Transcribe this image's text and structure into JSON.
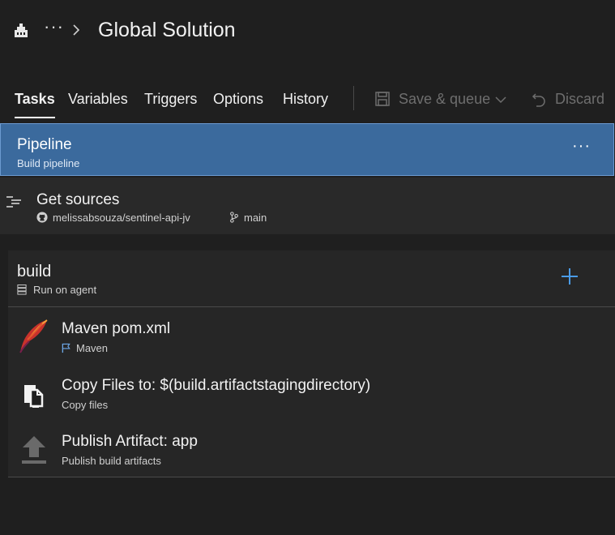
{
  "header": {
    "breadcrumb_more": "···",
    "title": "Global Solution"
  },
  "tabs": [
    {
      "label": "Tasks",
      "active": true
    },
    {
      "label": "Variables",
      "active": false
    },
    {
      "label": "Triggers",
      "active": false
    },
    {
      "label": "Options",
      "active": false
    },
    {
      "label": "History",
      "active": false
    }
  ],
  "commands": {
    "save_queue": "Save & queue",
    "discard": "Discard",
    "disabled": true
  },
  "pipeline": {
    "name": "Pipeline",
    "subtitle": "Build pipeline",
    "more": "···"
  },
  "sources": {
    "name": "Get sources",
    "repo": "melissabsouza/sentinel-api-jv",
    "branch": "main"
  },
  "job": {
    "name": "build",
    "subtitle": "Run on agent",
    "tasks": [
      {
        "name": "Maven pom.xml",
        "subtitle": "Maven",
        "icon": "maven-feather-icon"
      },
      {
        "name": "Copy Files to: $(build.artifactstagingdirectory)",
        "subtitle": "Copy files",
        "icon": "copy-files-icon"
      },
      {
        "name": "Publish Artifact: app",
        "subtitle": "Publish build artifacts",
        "icon": "publish-artifact-icon"
      }
    ]
  },
  "colors": {
    "background": "#1f1f1f",
    "selected": "#3b6a9d",
    "accent": "#4a9be8"
  }
}
